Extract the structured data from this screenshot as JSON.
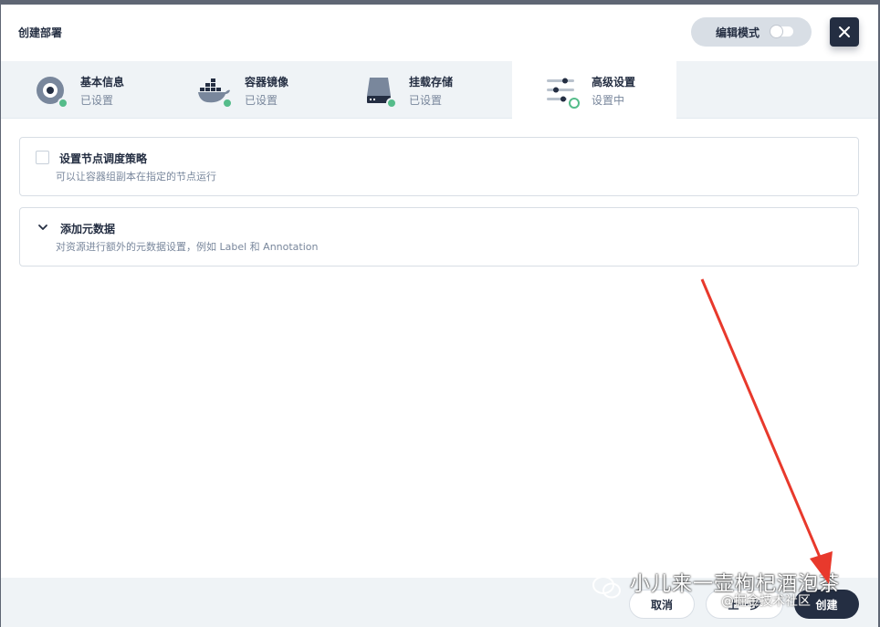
{
  "header": {
    "title": "创建部署",
    "edit_mode_label": "编辑模式"
  },
  "steps": [
    {
      "name": "基本信息",
      "status": "已设置",
      "icon": "disk-icon"
    },
    {
      "name": "容器镜像",
      "status": "已设置",
      "icon": "docker-icon"
    },
    {
      "name": "挂载存储",
      "status": "已设置",
      "icon": "storage-icon"
    },
    {
      "name": "高级设置",
      "status": "设置中",
      "icon": "sliders-icon"
    }
  ],
  "cards": {
    "node_schedule": {
      "title": "设置节点调度策略",
      "desc": "可以让容器组副本在指定的节点运行"
    },
    "metadata": {
      "title": "添加元数据",
      "desc": "对资源进行额外的元数据设置，例如 Label 和 Annotation"
    }
  },
  "footer": {
    "cancel": "取消",
    "prev": "上一步",
    "create": "创建"
  },
  "watermark": {
    "text": "小儿来一壶枸杞酒泡茶",
    "sub": "@掘金技术社区"
  },
  "colors": {
    "primary": "#242e42",
    "success": "#55bc8a",
    "arrow": "#e8392c"
  }
}
